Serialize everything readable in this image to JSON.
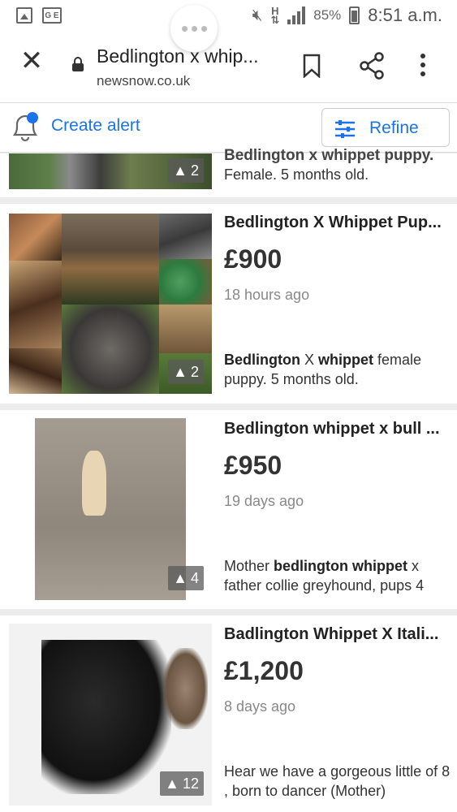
{
  "status_bar": {
    "battery": "85%",
    "time": "8:51 a.m.",
    "network_label": "G E"
  },
  "browser": {
    "title": "Bedlington x whip...",
    "url": "newsnow.co.uk"
  },
  "toolbar": {
    "create_alert_label": "Create alert",
    "refine_label": "Refine",
    "accent_color": "#1a73e8"
  },
  "listings": [
    {
      "title": "Bedlington x whippet puppy.",
      "price": "",
      "time": "",
      "desc_parts": [
        "Female. 5 months old."
      ],
      "image_count": "2"
    },
    {
      "title": "Bedlington X Whippet Pup...",
      "price": "£900",
      "time": "18 hours ago",
      "desc_bold_1": "Bedlington",
      "desc_mid_1": " X ",
      "desc_bold_2": "whippet",
      "desc_rest": " female puppy. 5 months old.",
      "image_count": "2"
    },
    {
      "title": "Bedlington whippet x bull ...",
      "price": "£950",
      "time": "19 days ago",
      "desc_pre": "Mother ",
      "desc_bold_1": "bedlington whippet",
      "desc_rest": " x father collie greyhound, pups 4",
      "image_count": "4"
    },
    {
      "title": "Badlington Whippet X Itali...",
      "price": "£1,200",
      "time": "8 days ago",
      "desc": "Hear we have a gorgeous little of 8 , born to dancer (Mother)",
      "image_count": "12"
    }
  ]
}
